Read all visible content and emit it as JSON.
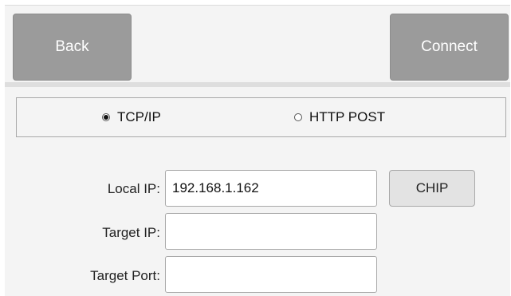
{
  "header": {
    "back_label": "Back",
    "connect_label": "Connect"
  },
  "protocol": {
    "options": [
      {
        "label": "TCP/IP",
        "selected": true
      },
      {
        "label": "HTTP POST",
        "selected": false
      }
    ]
  },
  "form": {
    "local_ip_label": "Local IP:",
    "local_ip_value": "192.168.1.162",
    "target_ip_label": "Target IP:",
    "target_ip_value": "",
    "target_port_label": "Target Port:",
    "target_port_value": "",
    "chip_label": "CHIP"
  },
  "colors": {
    "panel_bg": "#f4f4f4",
    "top_button_bg": "#9b9b9b",
    "chip_button_bg": "#e3e3e3",
    "border": "#a9a9a9"
  }
}
